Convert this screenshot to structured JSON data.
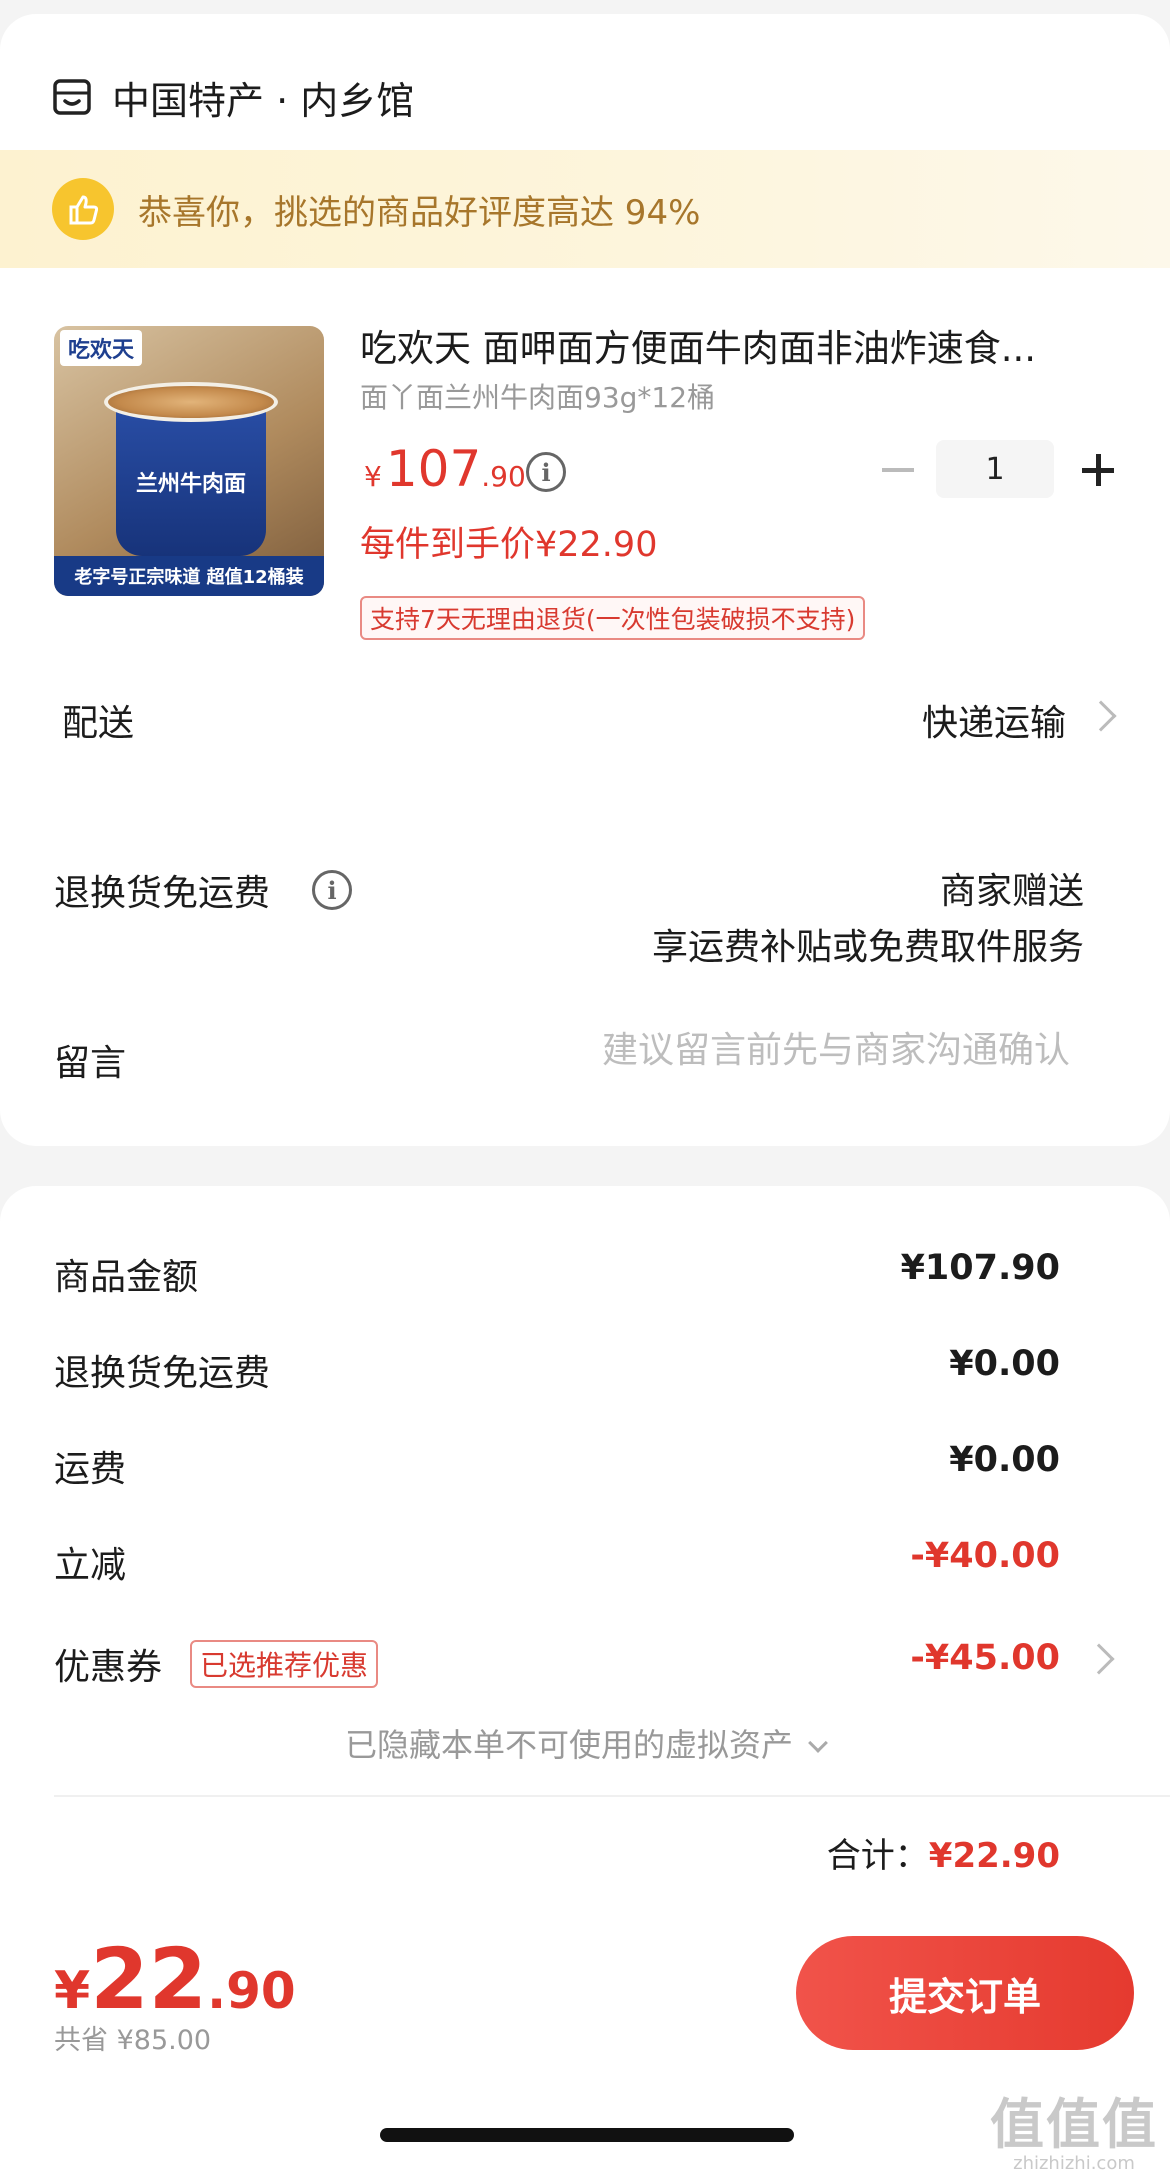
{
  "store": {
    "name": "中国特产 · 内乡馆",
    "icon": "store-icon"
  },
  "banner": {
    "text": "恭喜你，挑选的商品好评度高达 94%",
    "icon": "thumbs-up-icon",
    "bg": "#fdf3d6",
    "text_color": "#a7762b"
  },
  "product": {
    "image_brand": "吃欢天",
    "image_label": "兰州牛肉面",
    "image_strip": "老字号正宗味道 超值12桶装",
    "title": "吃欢天 面呷面方便面牛肉面非油炸速食...",
    "spec": "面丫面兰州牛肉面93g*12桶",
    "price_symbol": "¥",
    "price_int": "107",
    "price_dec": ".90",
    "quantity": "1",
    "unit_price": "每件到手价¥22.90",
    "return_policy": "支持7天无理由退货(一次性包装破损不支持)"
  },
  "delivery": {
    "label": "配送",
    "value": "快递运输"
  },
  "return_shipping": {
    "label": "退换货免运费",
    "value_line1": "商家赠送",
    "value_line2": "享运费补贴或免费取件服务"
  },
  "message": {
    "label": "留言",
    "placeholder": "建议留言前先与商家沟通确认"
  },
  "summary": {
    "goods_label": "商品金额",
    "goods_value": "¥107.90",
    "return_label": "退换货免运费",
    "return_value": "¥0.00",
    "shipping_label": "运费",
    "shipping_value": "¥0.00",
    "discount_label": "立减",
    "discount_value": "-¥40.00",
    "coupon_label": "优惠券",
    "coupon_badge": "已选推荐优惠",
    "coupon_value": "-¥45.00",
    "hidden_assets": "已隐藏本单不可使用的虚拟资产",
    "total_label": "合计：",
    "total_value": "¥22.90"
  },
  "footer": {
    "price_symbol": "¥",
    "price_int": "22",
    "price_dec": ".90",
    "saved": "共省 ¥85.00",
    "submit_label": "提交订单"
  },
  "watermark": {
    "main": "值值值",
    "sub": "zhizhizhi.com"
  },
  "colors": {
    "accent": "#e0372d",
    "background": "#f4f4f4"
  }
}
